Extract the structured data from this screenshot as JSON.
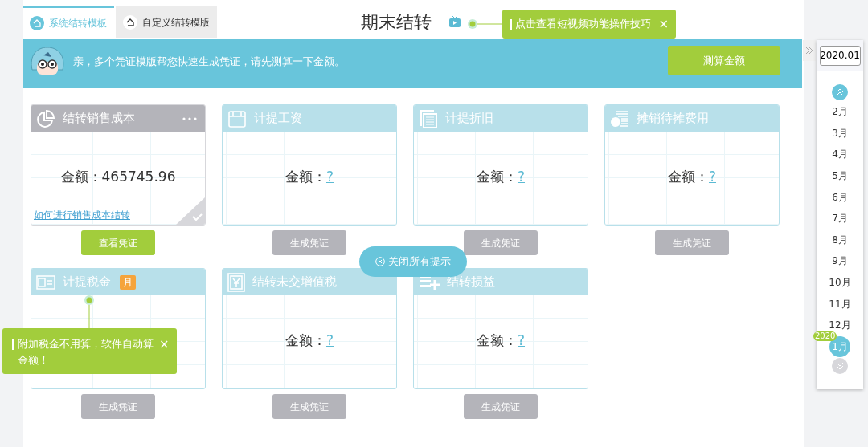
{
  "tabs": [
    {
      "label": "系统结转模板",
      "selected": true
    },
    {
      "label": "自定义结转模版",
      "selected": false
    }
  ],
  "title": "期末结转",
  "video_tip": {
    "text": "点击查看短视频功能操作技巧",
    "close": "×"
  },
  "banner": {
    "message": "亲，多个凭证模版帮您快速生成凭证，请先测算一下金额。",
    "button": "测算金额"
  },
  "cards": [
    {
      "title": "结转销售成本",
      "amount_label": "金额：",
      "amount": "465745.96",
      "calculated": true,
      "link": "如何进行销售成本结转",
      "button": {
        "label": "查看凭证",
        "enabled": true
      }
    },
    {
      "title": "计提工资",
      "amount_label": "金额：",
      "amount": "?",
      "calculated": false,
      "button": {
        "label": "生成凭证",
        "enabled": false
      }
    },
    {
      "title": "计提折旧",
      "amount_label": "金额：",
      "amount": "?",
      "calculated": false,
      "button": {
        "label": "生成凭证",
        "enabled": false
      }
    },
    {
      "title": "摊销待摊费用",
      "amount_label": "金额：",
      "amount": "?",
      "calculated": false,
      "button": {
        "label": "生成凭证",
        "enabled": false
      }
    },
    {
      "title": "计提税金",
      "badge": "月",
      "calculated": false,
      "button": {
        "label": "生成凭证",
        "enabled": false
      }
    },
    {
      "title": "结转未交增值税",
      "amount_label": "金额：",
      "amount": "?",
      "calculated": false,
      "button": {
        "label": "生成凭证",
        "enabled": false
      }
    },
    {
      "title": "结转损益",
      "amount_label": "金额：",
      "amount": "?",
      "calculated": false,
      "button": {
        "label": "生成凭证",
        "enabled": false
      }
    }
  ],
  "close_all_button": "关闭所有提示",
  "tax_tip": {
    "text": "附加税金不用算，软件自动算金额！",
    "close": "×"
  },
  "period_panel": {
    "date": "2020.01",
    "months": [
      {
        "label": "2月",
        "selected": false
      },
      {
        "label": "3月",
        "selected": false
      },
      {
        "label": "4月",
        "selected": false
      },
      {
        "label": "5月",
        "selected": false
      },
      {
        "label": "6月",
        "selected": false
      },
      {
        "label": "7月",
        "selected": false
      },
      {
        "label": "8月",
        "selected": false
      },
      {
        "label": "9月",
        "selected": false
      },
      {
        "label": "10月",
        "selected": false
      },
      {
        "label": "11月",
        "selected": false
      },
      {
        "label": "12月",
        "selected": false
      },
      {
        "label": "1月",
        "selected": true,
        "year_badge": "2020"
      }
    ]
  }
}
